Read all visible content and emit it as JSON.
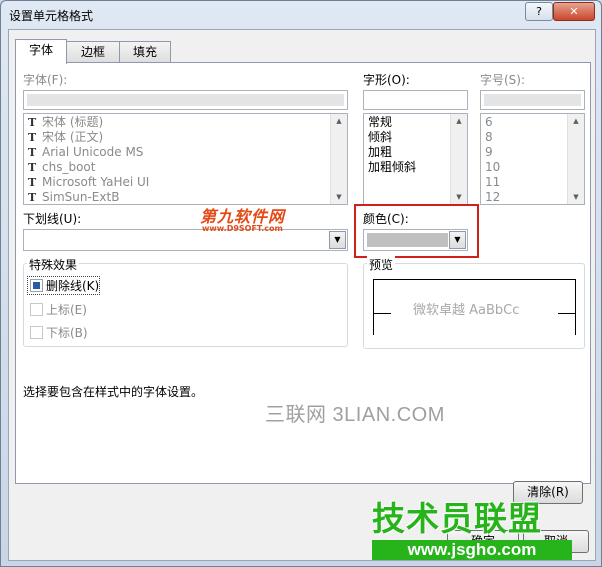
{
  "window": {
    "title": "设置单元格格式",
    "help_glyph": "?",
    "close_glyph": "✕"
  },
  "tabs": [
    {
      "label": "字体"
    },
    {
      "label": "边框"
    },
    {
      "label": "填充"
    }
  ],
  "font": {
    "label": "字体(F):",
    "items": [
      {
        "icon": "truetype-font-icon",
        "name": "宋体 (标题)"
      },
      {
        "icon": "truetype-font-icon",
        "name": "宋体 (正文)"
      },
      {
        "icon": "truetype-font-icon",
        "name": "Arial Unicode MS"
      },
      {
        "icon": "truetype-font-icon",
        "name": "chs_boot"
      },
      {
        "icon": "truetype-font-icon",
        "name": "Microsoft YaHei UI"
      },
      {
        "icon": "truetype-font-icon",
        "name": "SimSun-ExtB"
      }
    ]
  },
  "style": {
    "label": "字形(O):",
    "items": [
      "常规",
      "倾斜",
      "加粗",
      "加粗倾斜"
    ]
  },
  "size": {
    "label": "字号(S):",
    "items": [
      "6",
      "8",
      "9",
      "10",
      "11",
      "12"
    ]
  },
  "underline": {
    "label": "下划线(U):",
    "value": ""
  },
  "color": {
    "label": "颜色(C):",
    "swatch": "#c0c0c0"
  },
  "effects": {
    "label": "特殊效果",
    "strikethrough": {
      "label": "删除线(K)",
      "checked": true
    },
    "superscript": {
      "label": "上标(E)",
      "checked": false
    },
    "subscript": {
      "label": "下标(B)",
      "checked": false
    }
  },
  "preview": {
    "label": "预览",
    "sample": "微软卓越  AaBbCc"
  },
  "hint": "选择要包含在样式中的字体设置。",
  "buttons": {
    "clear": "清除(R)",
    "ok": "确定",
    "cancel": "取消"
  },
  "watermarks": {
    "d9soft_main": "第九软件网",
    "d9soft_url": "www.D9SOFT.com",
    "sanlian": "三联网 3LIAN.COM",
    "jsgho_main": "技术员联盟",
    "jsgho_url": "www.jsgho.com"
  },
  "colors": {
    "highlight": "#d0201b",
    "watermark_green": "#27b31a",
    "watermark_orange": "#e44a16"
  }
}
